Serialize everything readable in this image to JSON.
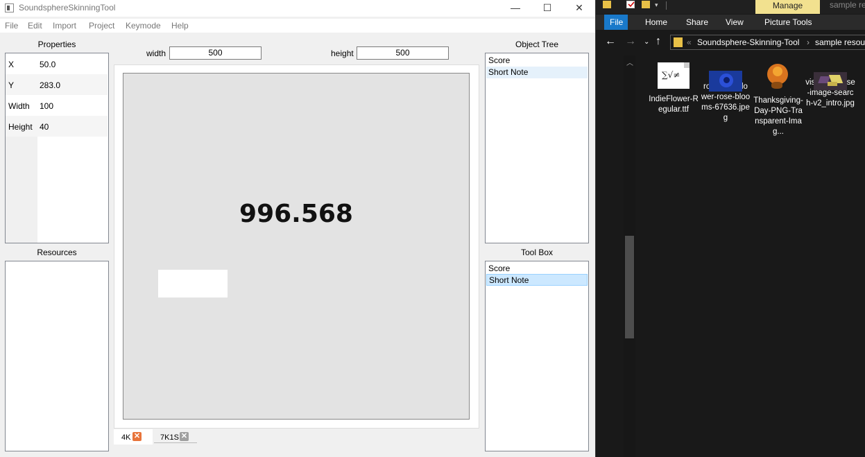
{
  "window": {
    "title": "SoundsphereSkinningTool",
    "minimize": "—",
    "maximize": "☐",
    "close": "✕"
  },
  "menu": [
    "File",
    "Edit",
    "Import",
    "Project",
    "Keymode",
    "Help"
  ],
  "properties": {
    "title": "Properties",
    "rows": [
      {
        "key": "X",
        "value": "50.0"
      },
      {
        "key": "Y",
        "value": "283.0"
      },
      {
        "key": "Width",
        "value": "100"
      },
      {
        "key": "Height",
        "value": "40"
      }
    ]
  },
  "resources": {
    "title": "Resources"
  },
  "canvas_settings": {
    "width_label": "width",
    "width_value": "500",
    "height_label": "height",
    "height_value": "500"
  },
  "canvas": {
    "score_text": "996.568"
  },
  "tabs": [
    {
      "label": "4K",
      "close": "✕",
      "close_color": "#e8743b"
    },
    {
      "label": "7K1S",
      "close": "✕",
      "close_color": "#a0a0a0"
    }
  ],
  "object_tree": {
    "title": "Object Tree",
    "items": [
      "Score",
      "Short Note"
    ],
    "selected": "Short Note"
  },
  "tool_box": {
    "title": "Tool Box",
    "items": [
      "Score",
      "Short Note"
    ],
    "selected": "Short Note"
  },
  "explorer": {
    "ribbon_context_tab": "Manage",
    "window_title": "sample re",
    "ribbon_tabs": [
      "File",
      "Home",
      "Share",
      "View",
      "Picture Tools"
    ],
    "address": {
      "separator": "«",
      "path": [
        "Soundsphere-Skinning-Tool",
        "sample resour"
      ],
      "chevron": "›"
    },
    "files": [
      {
        "name": "IndieFlower-Regular.ttf",
        "icon": "font-file-icon",
        "glyph": "∑√≠"
      },
      {
        "name": "rose-blue-flower-rose-blooms-67636.jpeg",
        "icon": "image-thumbnail-blue-rose"
      },
      {
        "name": "Thanksgiving-Day-PNG-Transparent-Imag...",
        "icon": "image-thumbnail-turkey"
      },
      {
        "name": "visual-reverse-image-search-v2_intro.jpg",
        "icon": "image-thumbnail-butterfly"
      }
    ],
    "accent_color": "#1979ca"
  }
}
